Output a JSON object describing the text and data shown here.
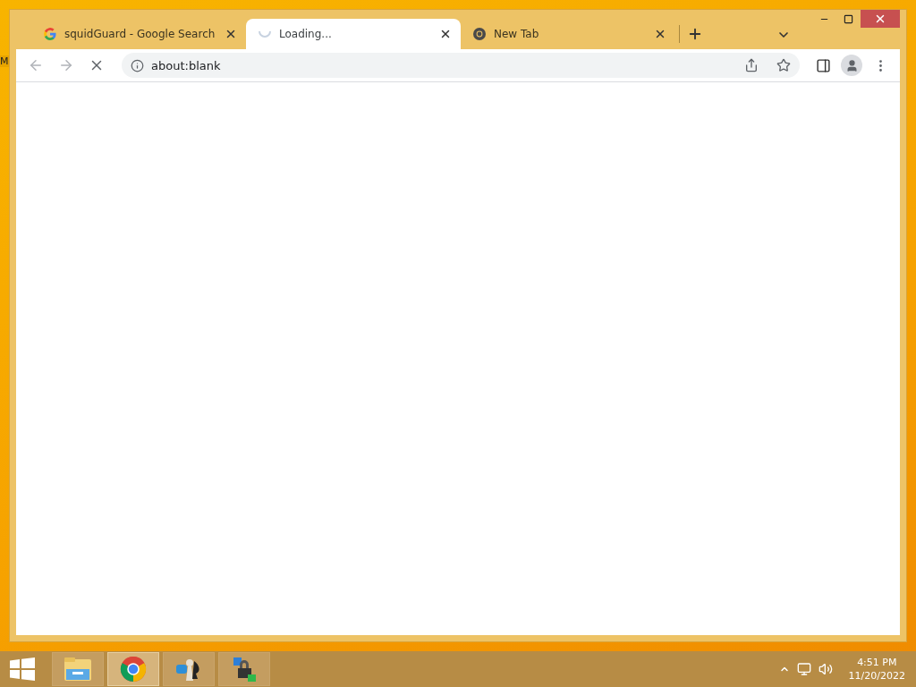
{
  "desktop": {
    "icon_label": "M"
  },
  "tabs": [
    {
      "title": "squidGuard - Google Search",
      "kind": "google",
      "selected": false
    },
    {
      "title": "Loading...",
      "kind": "loading",
      "selected": true
    },
    {
      "title": "New Tab",
      "kind": "chrome",
      "selected": false
    }
  ],
  "toolbar": {
    "address": "about:blank",
    "loading": true
  },
  "taskbar": {
    "apps": [
      {
        "kind": "folder",
        "selected": false
      },
      {
        "kind": "chrome",
        "selected": true
      },
      {
        "kind": "games",
        "selected": false
      },
      {
        "kind": "lock",
        "selected": false
      }
    ],
    "time": "4:51 PM",
    "date": "11/20/2022"
  }
}
